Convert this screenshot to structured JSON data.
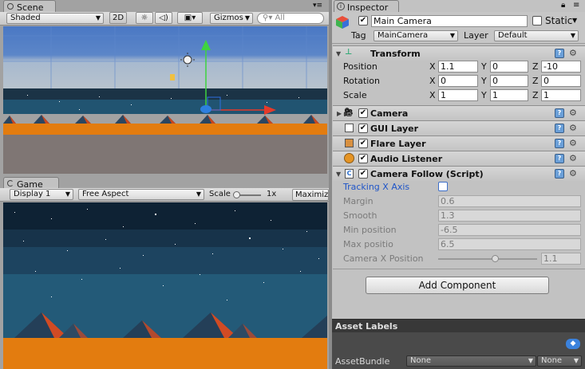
{
  "scene": {
    "tab_label": "Scene",
    "shading": "Shaded",
    "mode_2d": "2D",
    "gizmos": "Gizmos",
    "search_placeholder": "All"
  },
  "game": {
    "tab_label": "Game",
    "display": "Display 1",
    "aspect": "Free Aspect",
    "scale_label": "Scale",
    "scale_value": "1x",
    "maximize": "Maximiz",
    "scale_slider_fraction": 0.05
  },
  "inspector": {
    "tab_label": "Inspector",
    "object_name": "Main Camera",
    "active": true,
    "static_label": "Static",
    "static_checked": false,
    "tag_label": "Tag",
    "tag_value": "MainCamera",
    "layer_label": "Layer",
    "layer_value": "Default",
    "transform": {
      "title": "Transform",
      "rows": [
        {
          "label": "Position",
          "x": "1.1",
          "y": "0",
          "z": "-10"
        },
        {
          "label": "Rotation",
          "x": "0",
          "y": "0",
          "z": "0"
        },
        {
          "label": "Scale",
          "x": "1",
          "y": "1",
          "z": "1"
        }
      ],
      "axis_x": "X",
      "axis_y": "Y",
      "axis_z": "Z"
    },
    "components": [
      {
        "name": "Camera",
        "enabled": true
      },
      {
        "name": "GUI Layer",
        "enabled": true
      },
      {
        "name": "Flare Layer",
        "enabled": true
      },
      {
        "name": "Audio Listener",
        "enabled": true
      },
      {
        "name": "Camera Follow (Script)",
        "enabled": true
      }
    ],
    "camera_follow": {
      "tracking_label": "Tracking X Axis",
      "tracking_checked": false,
      "margin_label": "Margin",
      "margin_value": "0.6",
      "smooth_label": "Smooth",
      "smooth_value": "1.3",
      "min_label": "Min position",
      "min_value": "-6.5",
      "max_label": "Max positio",
      "max_value": "6.5",
      "camx_label": "Camera X Position",
      "camx_value": "1.1",
      "camx_slider_fraction": 0.58
    },
    "add_component": "Add Component",
    "asset_labels": "Asset Labels",
    "assetbundle_label": "AssetBundle",
    "assetbundle_value": "None",
    "assetbundle_variant": "None"
  },
  "colors": {
    "sky_dark": "#0e2234",
    "sky_mid": "#1e4560",
    "sea": "#235a78",
    "ground": "#e37c0f",
    "mountain": "#243f58",
    "mountain_accent": "#d14b24",
    "selection_blue": "#1f6fd6"
  }
}
